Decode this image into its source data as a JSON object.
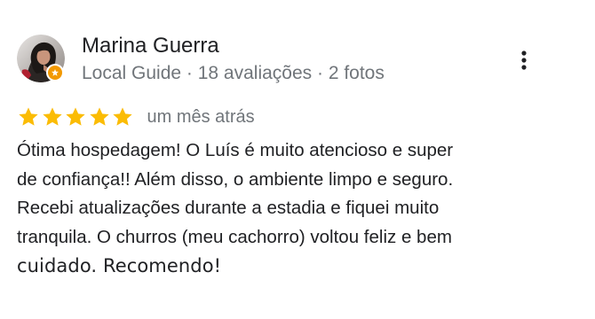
{
  "review": {
    "reviewer": {
      "name": "Marina Guerra",
      "meta": "Local Guide · 18 avaliações · 2 fotos",
      "avatar_icon": "profile-photo",
      "badge_icon": "local-guide-badge-icon",
      "badge_color": "#f29900"
    },
    "more_icon": "more-vert-icon",
    "rating": {
      "stars": 5,
      "max": 5,
      "star_color": "#fbbc04"
    },
    "date": "um mês atrás",
    "text_lines": [
      "Ótima hospedagem! O Luís é muito atencioso e super",
      "de confiança!! Além disso, o ambiente limpo e seguro.",
      "Recebi atualizações durante a estadia e fiquei muito",
      "tranquila. O churros (meu cachorro) voltou feliz e bem",
      "cuidado. Recomendo!"
    ]
  }
}
